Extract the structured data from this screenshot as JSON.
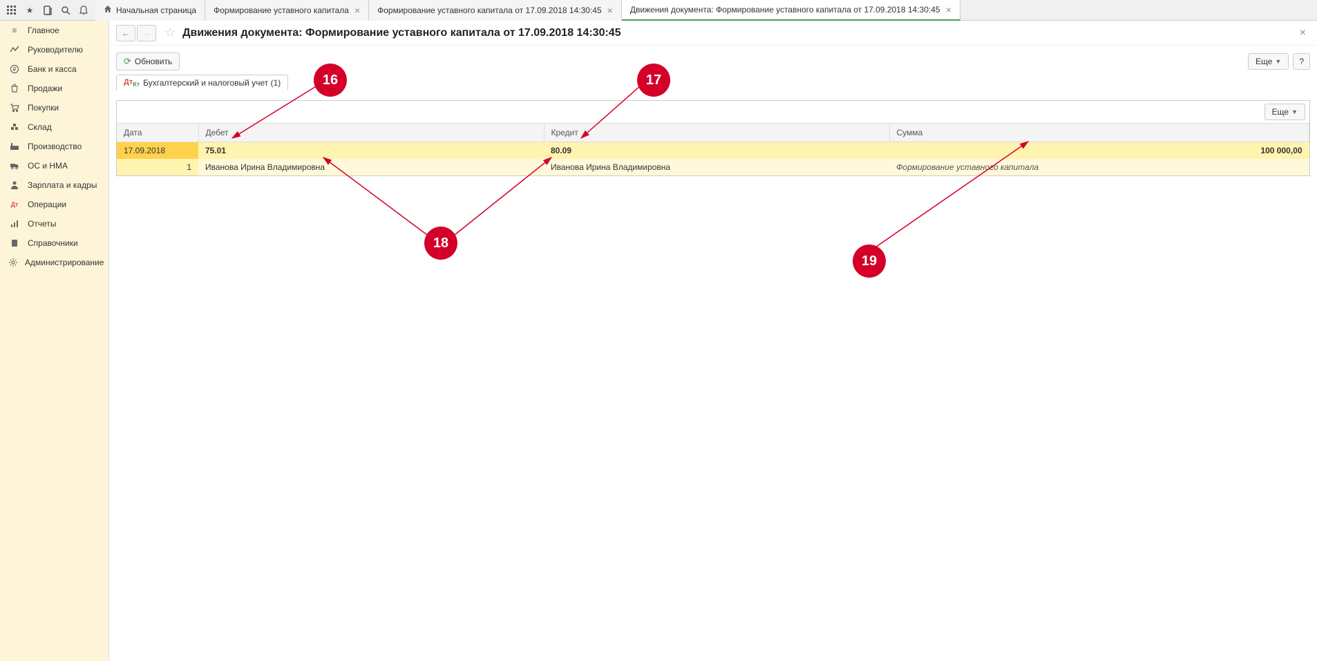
{
  "tabs": {
    "home": "Начальная страница",
    "t1": "Формирование уставного капитала",
    "t2": "Формирование уставного капитала от 17.09.2018 14:30:45",
    "t3": "Движения документа: Формирование уставного капитала от 17.09.2018 14:30:45"
  },
  "sidebar": [
    {
      "label": "Главное"
    },
    {
      "label": "Руководителю"
    },
    {
      "label": "Банк и касса"
    },
    {
      "label": "Продажи"
    },
    {
      "label": "Покупки"
    },
    {
      "label": "Склад"
    },
    {
      "label": "Производство"
    },
    {
      "label": "ОС и НМА"
    },
    {
      "label": "Зарплата и кадры"
    },
    {
      "label": "Операции"
    },
    {
      "label": "Отчеты"
    },
    {
      "label": "Справочники"
    },
    {
      "label": "Администрирование"
    }
  ],
  "page": {
    "title": "Движения документа: Формирование уставного капитала от 17.09.2018 14:30:45",
    "refresh": "Обновить",
    "more": "Еще",
    "help": "?",
    "inner_tab": "Бухгалтерский и налоговый учет (1)"
  },
  "table": {
    "headers": {
      "date": "Дата",
      "debit": "Дебет",
      "credit": "Кредит",
      "sum": "Сумма"
    },
    "row1": {
      "date": "17.09.2018",
      "debit": "75.01",
      "credit": "80.09",
      "sum": "100 000,00"
    },
    "row2": {
      "seq": "1",
      "debit": "Иванова Ирина Владимировна",
      "credit": "Иванова Ирина Владимировна",
      "desc": "Формирование уставного капитала"
    }
  },
  "annotations": {
    "a16": "16",
    "a17": "17",
    "a18": "18",
    "a19": "19"
  }
}
